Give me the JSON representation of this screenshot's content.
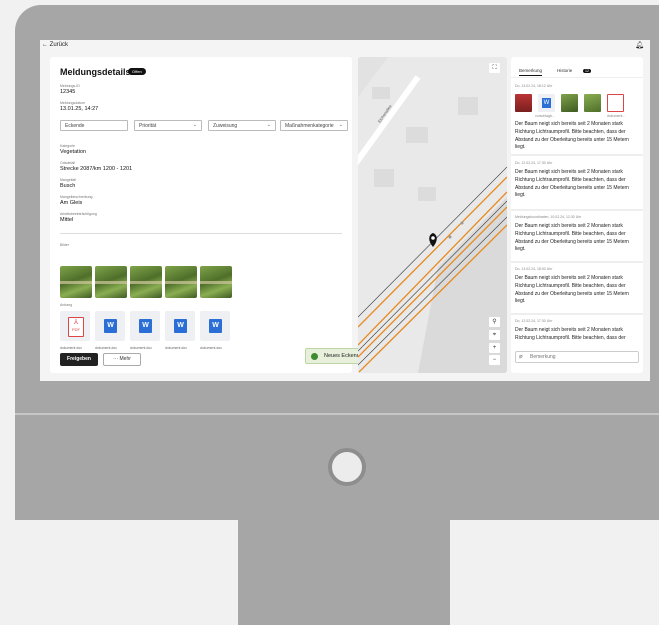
{
  "topbar": {
    "back_label": "← Zurück",
    "bell_icon": "bell-icon"
  },
  "details": {
    "title": "Meldungsdetails",
    "status_badge": "Offen",
    "fields": [
      {
        "label": "Meldungs-ID",
        "value": "12345"
      },
      {
        "label": "Meldungsdatum",
        "value": "13.01.25, 14:27"
      },
      {
        "label": "Kategorie",
        "value": "Vegetation"
      },
      {
        "label": "Ortsdetail",
        "value": "Strecke 2087/km 1200 - 1201"
      },
      {
        "label": "Mangelfall",
        "value": "Busch"
      },
      {
        "label": "Mangelbeschreibung",
        "value": "Am Gleis"
      },
      {
        "label": "Arbeitsbeeinträchtigung",
        "value": "Mittel"
      }
    ],
    "selects": [
      {
        "value": "Eckende",
        "has_chevron": false
      },
      {
        "value": "Priorität",
        "has_chevron": true
      },
      {
        "value": "Zuweisung",
        "has_chevron": true
      },
      {
        "value": "Maßnahmenkategorie",
        "has_chevron": true
      }
    ],
    "images_label": "Bilder",
    "attachments_label": "Anhang",
    "attachments": [
      {
        "type": "pdf",
        "icon_text": "PDF",
        "name": "dokument.doc"
      },
      {
        "type": "word",
        "icon_text": "W",
        "name": "dokument.doc"
      },
      {
        "type": "word",
        "icon_text": "W",
        "name": "dokument.doc"
      },
      {
        "type": "word",
        "icon_text": "W",
        "name": "dokument.doc"
      },
      {
        "type": "word",
        "icon_text": "W",
        "name": "dokument.doc"
      }
    ],
    "primary_button": "Freigeben",
    "secondary_button": "··· Mehr"
  },
  "toast": {
    "text": "Neues Eckende bestätigt",
    "close": "✕"
  },
  "map": {
    "street_label": "Eichenallee",
    "buttons": [
      "⛶",
      "⚲",
      "⌖",
      "+",
      "−"
    ]
  },
  "comments": {
    "tabs": [
      "Bemerkung",
      "Historie"
    ],
    "history_count": "12",
    "entries": [
      {
        "timestamp": "Do, 13.02.24, 18:12 Uhr",
        "text": "Der Baum neigt sich bereits seit 2 Monaten stark Richtung Lichtraumprofil. Bitte beachten, dass der Abstand zu der Oberleitung bereits unter 15 Metern liegt."
      },
      {
        "timestamp": "Do, 12.02.24, 17:30 Uhr",
        "text": "Der Baum neigt sich bereits seit 2 Monaten stark Richtung Lichtraumprofil. Bitte beachten, dass der Abstand zu der Oberleitung bereits unter 15 Metern liegt."
      },
      {
        "timestamp": "Meldungskoordinaten, 10.02.24, 12:30 Uhr",
        "text": "Der Baum neigt sich bereits seit 2 Monaten stark Richtung Lichtraumprofil. Bitte beachten, dass der Abstand zu der Oberleitung bereits unter 15 Metern liegt."
      },
      {
        "timestamp": "Do, 13.02.24, 18:00 Uhr",
        "text": "Der Baum neigt sich bereits seit 2 Monaten stark Richtung Lichtraumprofil. Bitte beachten, dass der Abstand zu der Oberleitung bereits unter 15 Metern liegt."
      },
      {
        "timestamp": "Do, 12.02.24, 17:30 Uhr",
        "text": "Der Baum neigt sich bereits seit 2 Monaten stark Richtung Lichtraumprofil. Bitte beachten, dass der"
      }
    ],
    "attachment_captions": [
      "vorschlagb...",
      "dokument..."
    ],
    "input_placeholder": "Bemerkung"
  }
}
